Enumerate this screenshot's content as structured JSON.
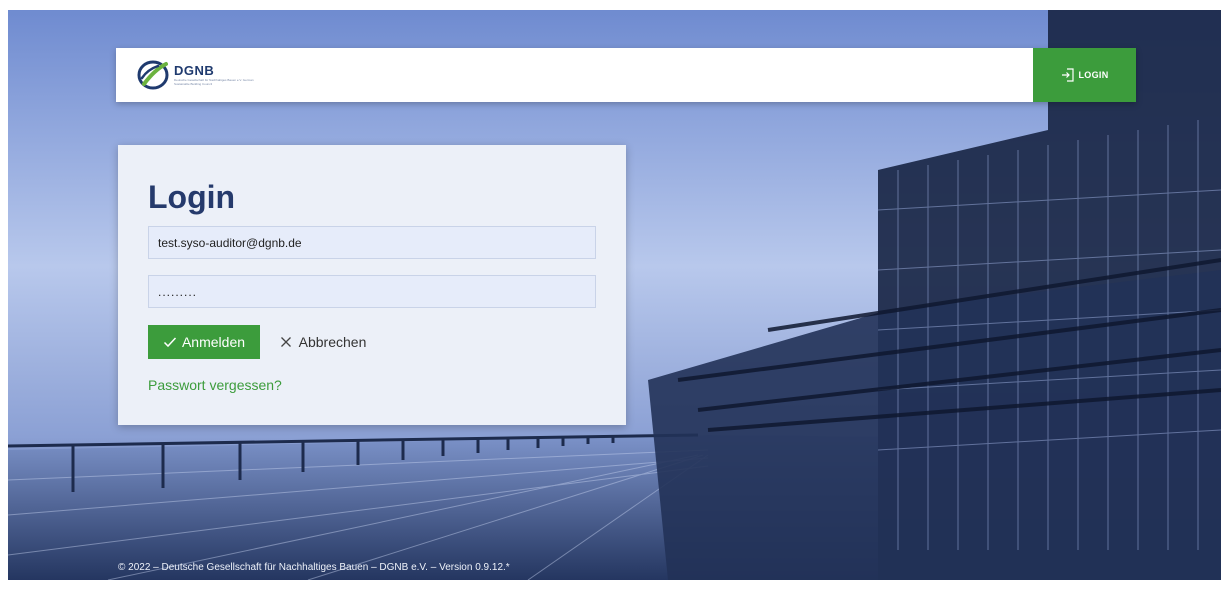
{
  "header": {
    "brand_name": "DGNB",
    "brand_tagline": "Deutsche Gesellschaft für Nachhaltiges Bauen e.V. German Sustainable Building Council",
    "login_label": "LOGIN",
    "login_icon": "login-icon",
    "accent_color": "#3c9c3c"
  },
  "login_form": {
    "title": "Login",
    "email_value": "test.syso-auditor@dgnb.de",
    "password_value": ".........",
    "submit_label": "Anmelden",
    "submit_icon": "check-icon",
    "cancel_label": "Abbrechen",
    "cancel_icon": "close-icon",
    "forgot_label": "Passwort vergessen?"
  },
  "footer": {
    "text": "© 2022 – Deutsche Gesellschaft für Nachhaltiges Bauen – DGNB e.V. – Version 0.9.12.*"
  }
}
